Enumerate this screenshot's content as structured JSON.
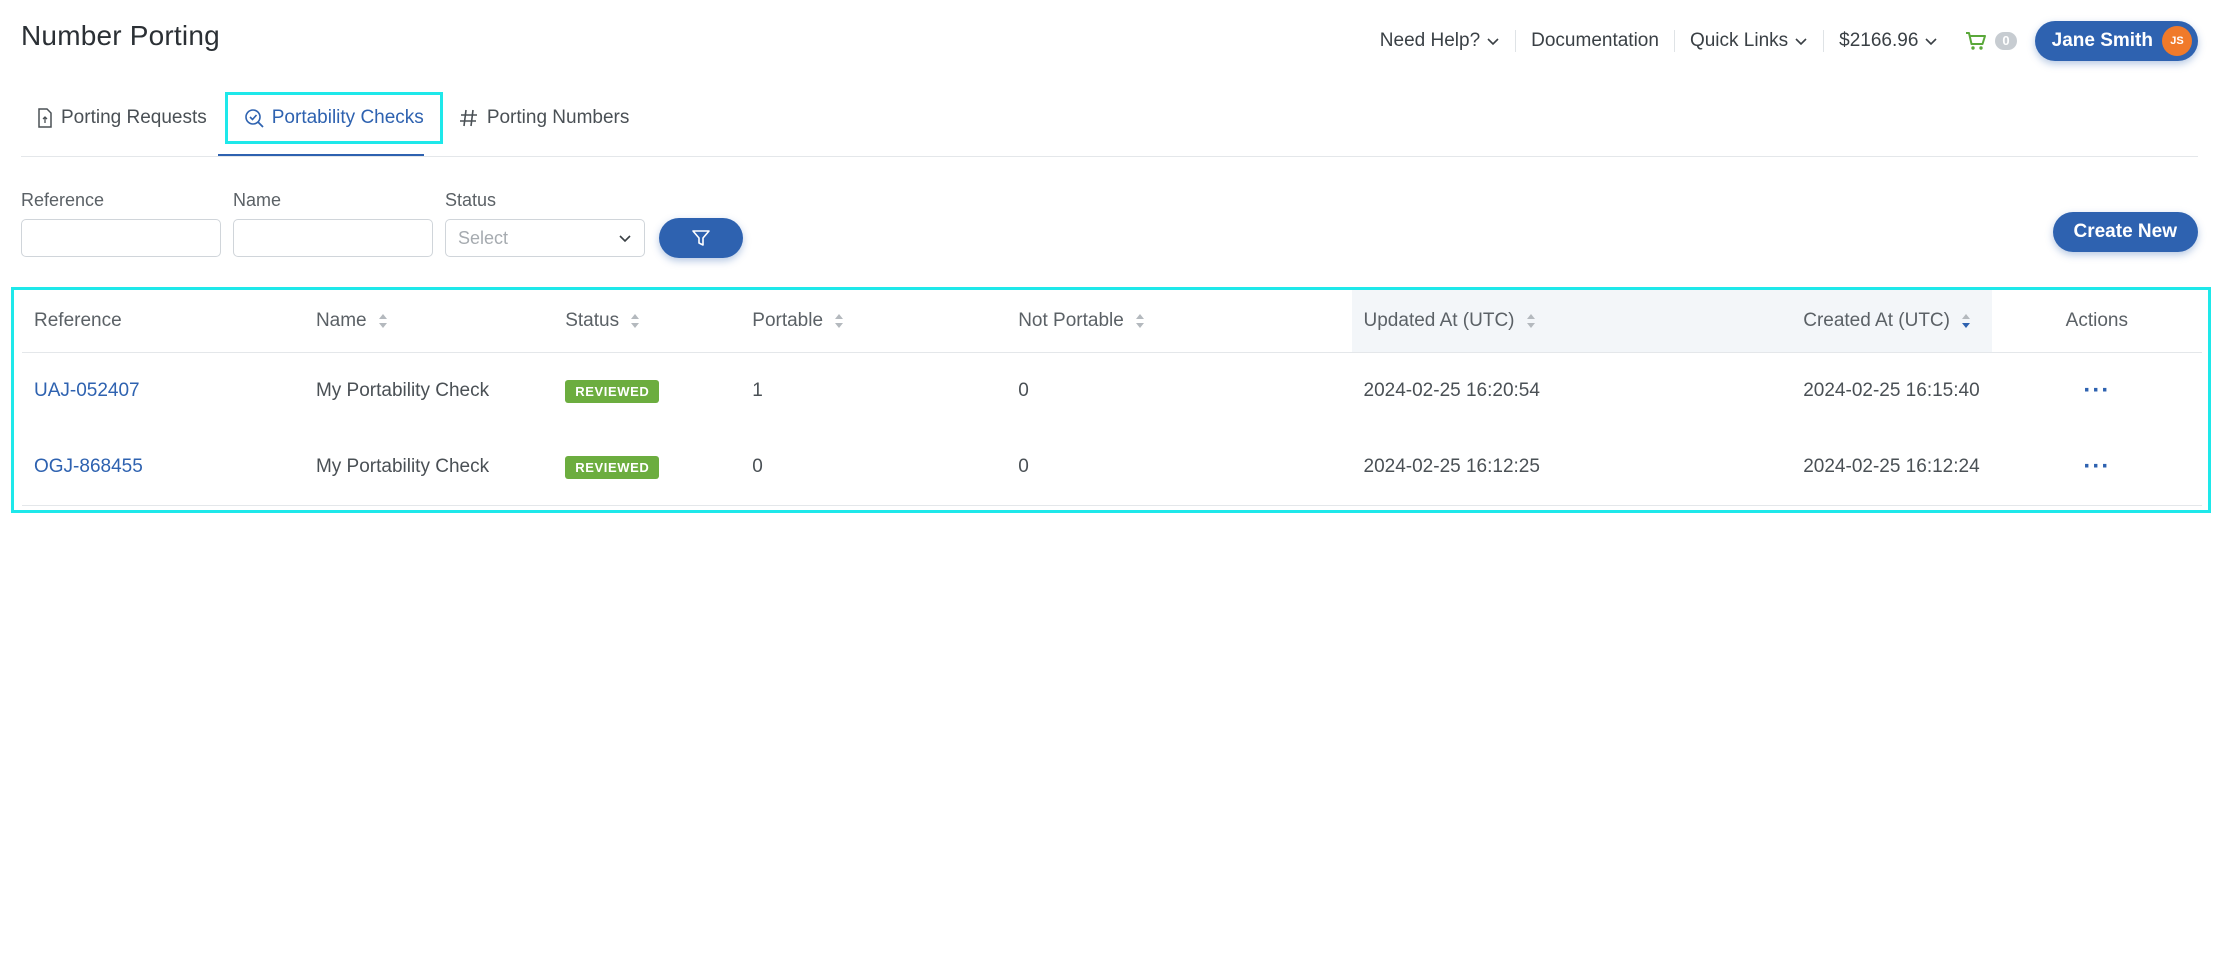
{
  "page": {
    "title": "Number Porting"
  },
  "header": {
    "help_label": "Need Help?",
    "docs_label": "Documentation",
    "quick_links_label": "Quick Links",
    "balance": "$2166.96",
    "cart_count": "0",
    "user_name": "Jane Smith",
    "user_initials": "JS"
  },
  "tabs": [
    {
      "label": "Porting Requests",
      "icon": "file-icon"
    },
    {
      "label": "Portability Checks",
      "icon": "check-search-icon",
      "active": true
    },
    {
      "label": "Porting Numbers",
      "icon": "hash-icon"
    }
  ],
  "filters": {
    "reference_label": "Reference",
    "reference_value": "",
    "name_label": "Name",
    "name_value": "",
    "status_label": "Status",
    "status_placeholder": "Select"
  },
  "actions": {
    "create_new_label": "Create New"
  },
  "table": {
    "columns": [
      "Reference",
      "Name",
      "Status",
      "Portable",
      "Not Portable",
      "Updated At (UTC)",
      "Created At (UTC)",
      "Actions"
    ],
    "rows": [
      {
        "reference": "UAJ-052407",
        "name": "My Portability Check",
        "status": "REVIEWED",
        "portable": "1",
        "not_portable": "0",
        "updated_at": "2024-02-25 16:20:54",
        "created_at": "2024-02-25 16:15:40",
        "actions": "···"
      },
      {
        "reference": "OGJ-868455",
        "name": "My Portability Check",
        "status": "REVIEWED",
        "portable": "0",
        "not_portable": "0",
        "updated_at": "2024-02-25 16:12:25",
        "created_at": "2024-02-25 16:12:24",
        "actions": "···"
      }
    ]
  },
  "colors": {
    "primary": "#2e62b0",
    "reviewed_badge": "#6cad3f",
    "highlight": "#1ee8ea",
    "avatar": "#f07a2a",
    "cart_icon": "#5aa83a"
  }
}
